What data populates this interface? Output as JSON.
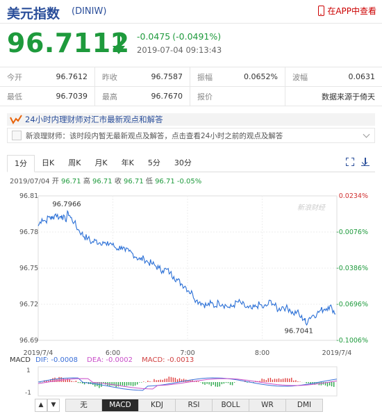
{
  "header": {
    "title": "美元指数",
    "code": "(DINIW)",
    "app_link": "在APP中查看"
  },
  "quote": {
    "price": "96.7112",
    "change": "-0.0475",
    "change_pct": "(-0.0491%)",
    "datetime": "2019-07-04 09:13:43"
  },
  "stats": [
    [
      {
        "k": "今开",
        "v": "96.7612"
      },
      {
        "k": "昨收",
        "v": "96.7587"
      },
      {
        "k": "振幅",
        "v": "0.0652%"
      },
      {
        "k": "波幅",
        "v": "0.0631"
      }
    ],
    [
      {
        "k": "最低",
        "v": "96.7039"
      },
      {
        "k": "最高",
        "v": "96.7670"
      },
      {
        "k": "报价",
        "v": ""
      },
      {
        "k": "",
        "v": "数据来源于倚天"
      }
    ]
  ],
  "news": {
    "banner": "24小时内理财师对汇市最新观点和解答",
    "item": "新浪理财师：该时段内暂无最新观点及解答，点击查看24小时之前的观点及解答"
  },
  "tabs": [
    "1分",
    "日K",
    "周K",
    "月K",
    "年K",
    "5分",
    "30分"
  ],
  "active_tab": 0,
  "infoline": {
    "date": "2019/07/04",
    "open_label": "开",
    "open": "96.71",
    "high_label": "高",
    "high": "96.71",
    "close_label": "收",
    "close": "96.71",
    "low_label": "低",
    "low": "96.71",
    "pct": "-0.05%"
  },
  "watermark": "新浪财经",
  "macd": {
    "label": "MACD",
    "dif": "DIF: -0.0008",
    "dea": "DEA: -0.0002",
    "val": "MACD: -0.0013",
    "ymax_label": "1",
    "ymin_label": "-1"
  },
  "indicator_buttons": [
    "无",
    "MACD",
    "KDJ",
    "RSI",
    "BOLL",
    "WR",
    "DMI"
  ],
  "active_indicator": 1,
  "scroll_up": "▲",
  "scroll_down": "▼",
  "chart_data": {
    "type": "line",
    "y_ticks": [
      "96.81",
      "96.78",
      "96.75",
      "96.72",
      "96.69"
    ],
    "pct_ticks": [
      "0.0234%",
      "-0.0076%",
      "-0.0386%",
      "-0.0696%",
      "-0.1006%"
    ],
    "x_ticks": [
      "2019/7/4",
      "6:00",
      "7:00",
      "8:00",
      "2019/7/4"
    ],
    "ylim": [
      96.69,
      96.81
    ],
    "annotations": [
      {
        "label": "96.7966",
        "x_min": 24,
        "y": 96.7966
      },
      {
        "label": "96.7041",
        "x_min": 215,
        "y": 96.7041
      }
    ],
    "x_minutes_range": [
      0,
      240
    ],
    "series": [
      {
        "x": [
          0,
          3,
          6,
          9,
          11,
          14,
          17,
          19,
          22,
          24,
          26,
          29,
          32,
          35,
          37,
          40,
          43,
          46,
          49,
          52,
          55,
          58,
          61,
          64,
          67,
          70,
          73,
          76,
          79,
          82,
          85,
          88,
          91,
          94,
          97,
          100,
          103,
          106,
          109,
          112,
          115,
          118,
          121,
          124,
          127,
          130,
          133,
          136,
          139,
          142,
          145,
          148,
          151,
          154,
          157,
          160,
          163,
          166,
          169,
          172,
          175,
          178,
          181,
          184,
          187,
          190,
          193,
          196,
          199,
          202,
          205,
          208,
          211,
          214,
          215,
          218,
          221,
          224,
          227,
          230,
          233,
          236,
          239
        ],
        "values": [
          96.785,
          96.791,
          96.789,
          96.793,
          96.791,
          96.795,
          96.792,
          96.794,
          96.789,
          96.7966,
          96.792,
          96.788,
          96.782,
          96.779,
          96.776,
          96.775,
          96.771,
          96.773,
          96.771,
          96.772,
          96.769,
          96.771,
          96.768,
          96.766,
          96.768,
          96.764,
          96.764,
          96.762,
          96.759,
          96.757,
          96.758,
          96.755,
          96.754,
          96.752,
          96.75,
          96.748,
          96.749,
          96.746,
          96.743,
          96.74,
          96.737,
          96.735,
          96.731,
          96.729,
          96.723,
          96.722,
          96.72,
          96.719,
          96.721,
          96.718,
          96.722,
          96.72,
          96.719,
          96.717,
          96.719,
          96.722,
          96.721,
          96.718,
          96.717,
          96.716,
          96.718,
          96.72,
          96.717,
          96.719,
          96.723,
          96.719,
          96.715,
          96.718,
          96.717,
          96.716,
          96.712,
          96.714,
          96.709,
          96.708,
          96.7041,
          96.709,
          96.711,
          96.712,
          96.715,
          96.716,
          96.718,
          96.717,
          96.712
        ]
      }
    ]
  }
}
